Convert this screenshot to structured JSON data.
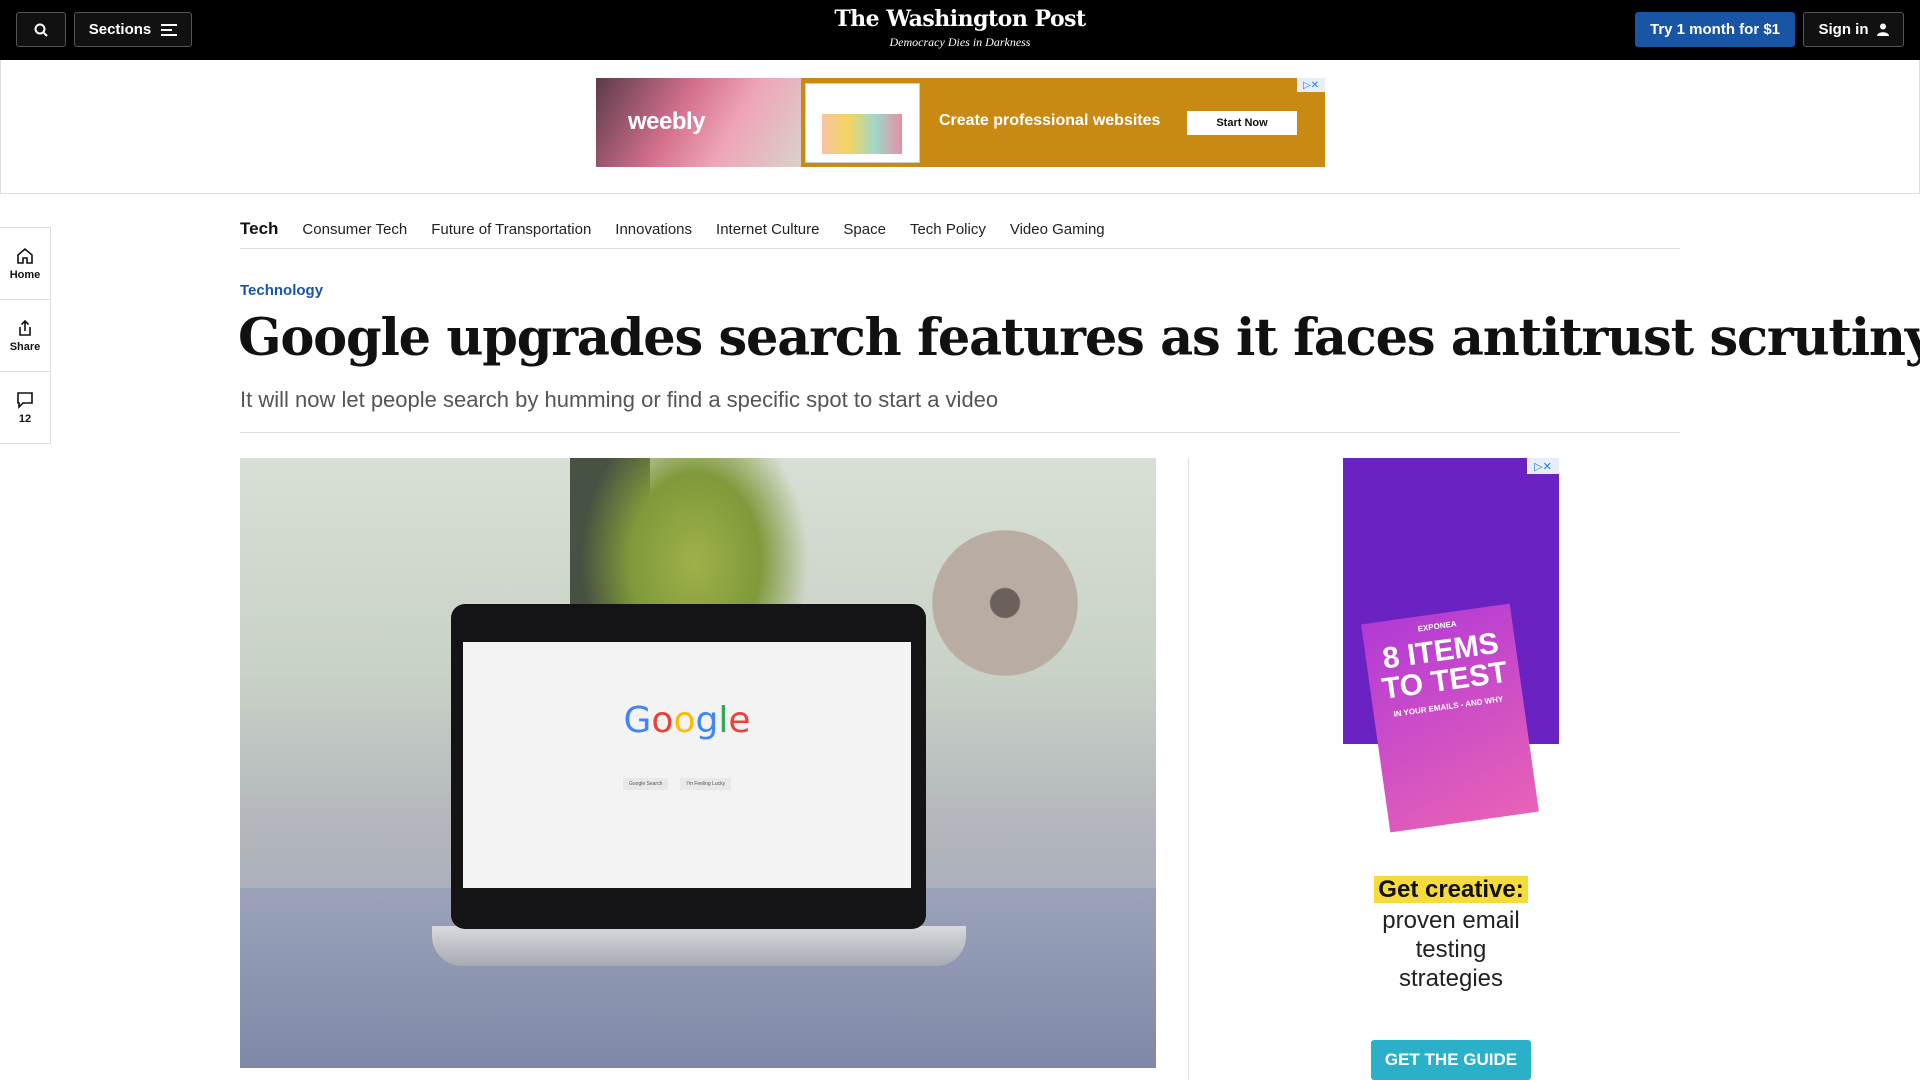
{
  "header": {
    "sections_label": "Sections",
    "logo_title": "The Washington Post",
    "logo_tagline": "Democracy Dies in Darkness",
    "subscribe_label": "Try 1 month for $1",
    "signin_label": "Sign in"
  },
  "top_ad": {
    "brand": "weebly",
    "headline": "Create professional websites",
    "cta": "Start Now"
  },
  "rail": {
    "home_label": "Home",
    "share_label": "Share",
    "comments_count": "12"
  },
  "subnav": {
    "section": "Tech",
    "items": [
      "Consumer Tech",
      "Future of Transportation",
      "Innovations",
      "Internet Culture",
      "Space",
      "Tech Policy",
      "Video Gaming"
    ]
  },
  "article": {
    "kicker": "Technology",
    "headline": "Google upgrades search features as it faces antitrust scrutiny",
    "dek": "It will now let people search by humming or find a specific spot to start a video"
  },
  "hero_image": {
    "screen_brand": "Google",
    "screen_btn_1": "Google Search",
    "screen_btn_2": "I'm Feeling Lucky"
  },
  "side_ad": {
    "brand": "EXPONEA",
    "book_title": "8 ITEMS TO TEST",
    "book_sub": "IN YOUR EMAILS - AND WHY",
    "headline": "Get creative:",
    "body": "proven email testing strategies",
    "cta": "GET THE GUIDE"
  },
  "colors": {
    "accent": "#1955a5",
    "topbar": "#000000",
    "ad_orange": "#c88a12",
    "ad_purple": "#6a23c2"
  }
}
